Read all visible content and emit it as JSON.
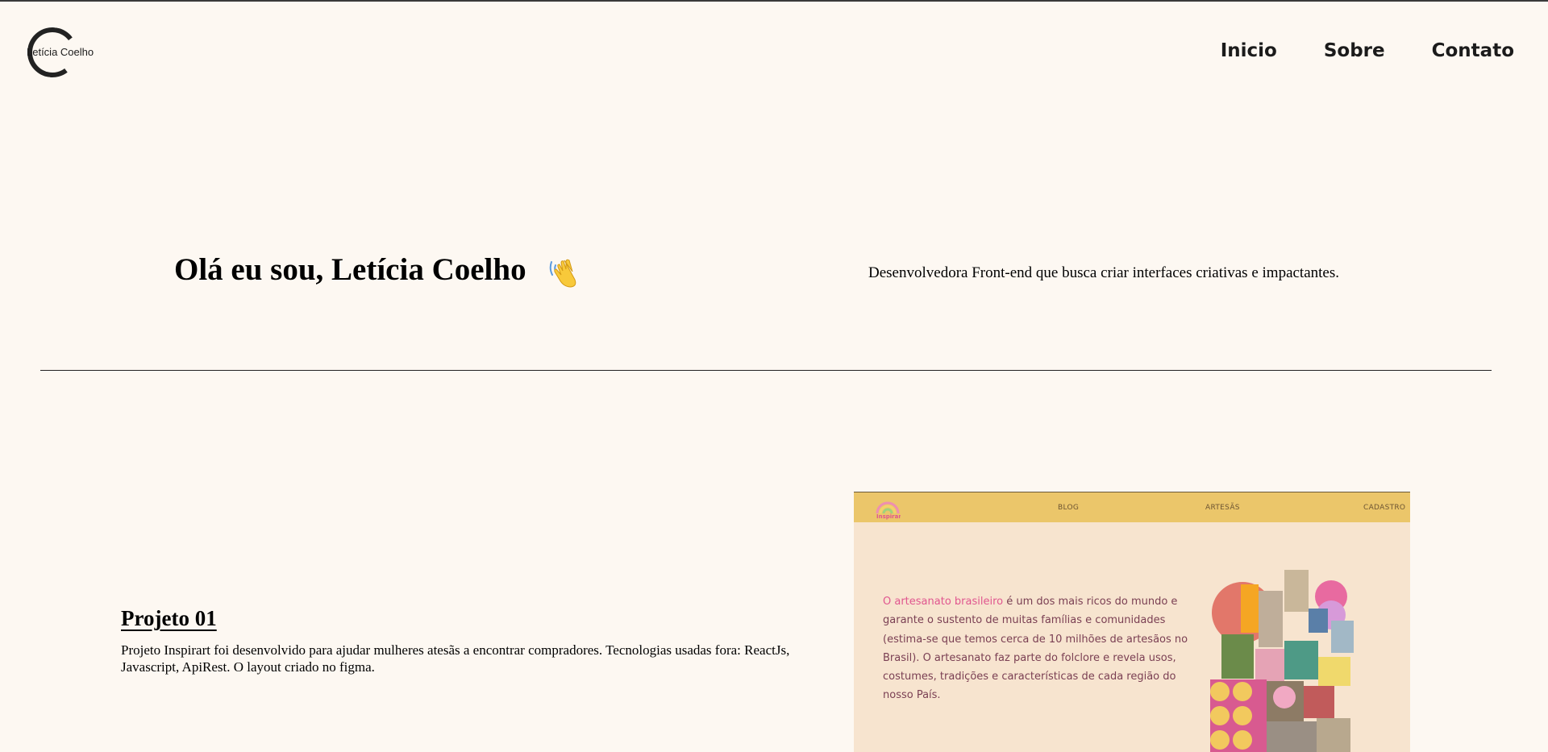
{
  "header": {
    "logo_text": "Letícia Coelho",
    "nav": [
      "Inicio",
      "Sobre",
      "Contato"
    ]
  },
  "hero": {
    "title": "Olá eu sou, Letícia Coelho",
    "wave_icon": "waving-hand-icon",
    "subtitle": "Desenvolvedora Front-end que busca criar interfaces criativas e impactantes."
  },
  "project": {
    "title": "Projeto 01",
    "description": "Projeto Inspirart foi desenvolvido para ajudar mulheres atesãs a encontrar compradores. Tecnologias usadas fora: ReactJs, Javascript, ApiRest. O layout criado no figma."
  },
  "preview": {
    "logo_text": "Inspirart",
    "nav": [
      "BLOG",
      "ARTESÃS",
      "CADASTRO"
    ],
    "highlight": "O artesanato brasileiro",
    "text": " é um dos mais ricos do mundo e garante o sustento de muitas famílias e comunidades (estima-se que temos cerca de 10 milhões de artesãos no Brasil). O artesanato faz parte do folclore e revela usos, costumes, tradições e características de cada região do nosso País."
  },
  "colors": {
    "background": "#fdf8f2",
    "preview_nav": "#ebc66a",
    "preview_bg": "#f7e4cf",
    "preview_highlight": "#e0568f",
    "preview_text": "#7a3f53"
  }
}
